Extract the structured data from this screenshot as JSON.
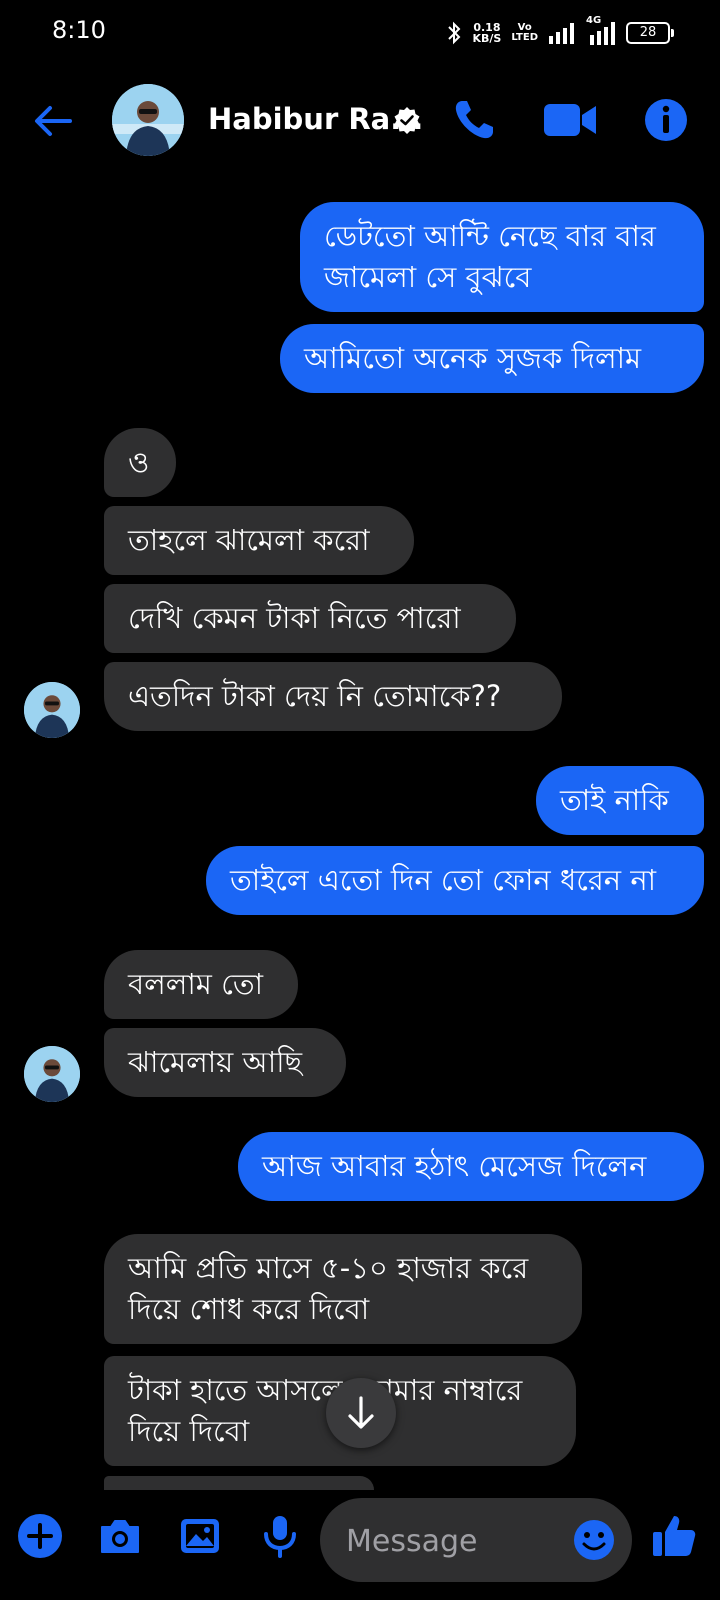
{
  "status_bar": {
    "time": "8:10",
    "net_speed_value": "0.18",
    "net_speed_unit": "KB/S",
    "volte_top": "Vo",
    "volte_bottom": "LTED",
    "network_type": "4G",
    "battery": "28"
  },
  "header": {
    "contact_name": "Habibur Ra...",
    "verified": true
  },
  "messages": [
    {
      "direction": "outgoing",
      "lines": [
        "ডেটতো আন্টি নেছে বার বার",
        "জামেলা সে বুঝবে"
      ]
    },
    {
      "direction": "outgoing",
      "lines": [
        "আমিতো অনেক সুজক দিলাম"
      ]
    },
    {
      "direction": "incoming",
      "lines": [
        "ও"
      ]
    },
    {
      "direction": "incoming",
      "lines": [
        "তাহলে ঝামেলা করো"
      ]
    },
    {
      "direction": "incoming",
      "lines": [
        "দেখি কেমন টাকা নিতে পারো"
      ]
    },
    {
      "direction": "incoming",
      "lines": [
        "এতদিন টাকা দেয় নি তোমাকে??"
      ]
    },
    {
      "direction": "outgoing",
      "lines": [
        "তাই নাকি"
      ]
    },
    {
      "direction": "outgoing",
      "lines": [
        "তাইলে এতো দিন তো ফোন ধরেন না"
      ]
    },
    {
      "direction": "incoming",
      "lines": [
        "বললাম তো"
      ]
    },
    {
      "direction": "incoming",
      "lines": [
        "ঝামেলায় আছি"
      ]
    },
    {
      "direction": "outgoing",
      "lines": [
        "আজ আবার হঠাৎ মেসেজ দিলেন"
      ]
    },
    {
      "direction": "incoming",
      "lines": [
        "আমি প্রতি মাসে ৫-১০ হাজার করে",
        "দিয়ে শোধ করে দিবো"
      ]
    },
    {
      "direction": "incoming",
      "lines": [
        "টাকা হাতে আসলে তোমার নাম্বারে",
        "দিয়ে দিবো"
      ]
    }
  ],
  "composer": {
    "placeholder": "Message"
  },
  "colors": {
    "accent": "#1b66f5",
    "incoming_bubble": "#2f2f30",
    "background": "#000000"
  },
  "icons": [
    "back-arrow-icon",
    "verified-badge-icon",
    "phone-icon",
    "video-camera-icon",
    "info-icon",
    "plus-icon",
    "camera-icon",
    "image-icon",
    "microphone-icon",
    "emoji-icon",
    "thumbs-up-icon",
    "arrow-down-icon"
  ]
}
